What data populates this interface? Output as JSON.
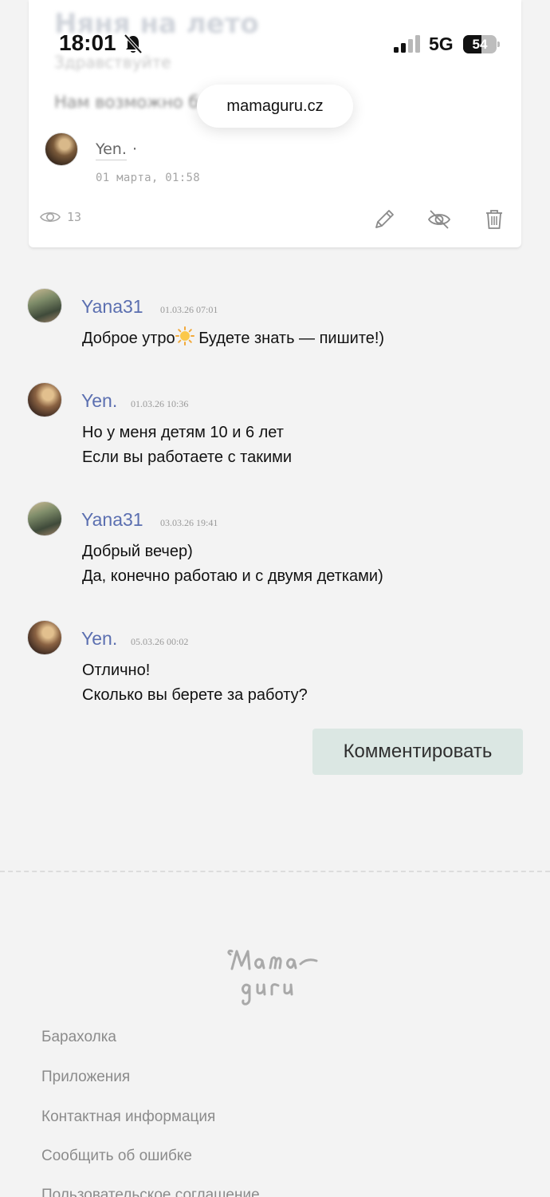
{
  "status_bar": {
    "time": "18:01",
    "network": "5G",
    "battery": "54",
    "battery_level": 0.54
  },
  "browser": {
    "url": "mamaguru.cz"
  },
  "post": {
    "title": "Няня на лето",
    "greeting": "Здравствуйте",
    "body": "Нам возможно б",
    "author": "Yen.",
    "author_suffix": "·",
    "date": "01 марта, 01:58",
    "views": "13",
    "icons": [
      "eye-icon",
      "pencil-icon",
      "eye-off-icon",
      "trash-icon"
    ]
  },
  "comments": [
    {
      "author": "Yana31",
      "time": "01.03.26 07:01",
      "text_before": "Доброе утро",
      "emoji": "sun-emoji",
      "text_after": " Будете знать — пишите!)"
    },
    {
      "author": "Yen.",
      "time": "01.03.26 10:36",
      "text": "Но у меня детям 10 и 6 лет\nЕсли вы работаете с такими"
    },
    {
      "author": "Yana31",
      "time": "03.03.26 19:41",
      "text": "Добрый вечер)\nДа, конечно работаю и с двумя детками)"
    },
    {
      "author": "Yen.",
      "time": "05.03.26 00:02",
      "text": "Отлично!\nСколько вы берете за работу?"
    }
  ],
  "actions": {
    "comment_button": "Комментировать"
  },
  "footer": {
    "logo": "Mama guru",
    "links": [
      "Барахолка",
      "Приложения",
      "Контактная информация",
      "Сообщить об ошибке",
      "Пользовательское соглашение"
    ]
  },
  "colors": {
    "author_link": "#5b6fb0",
    "button_bg": "#dbe7e3",
    "page_bg": "#f3f3f3"
  }
}
